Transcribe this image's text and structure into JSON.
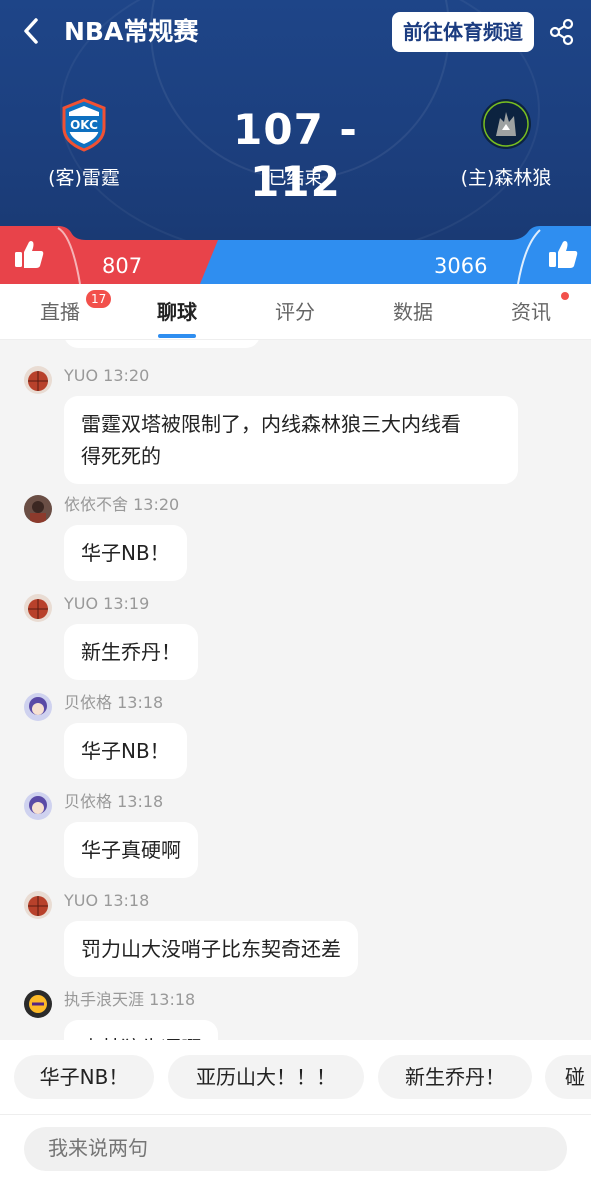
{
  "header": {
    "title": "NBA常规赛",
    "channel_button": "前往体育频道",
    "away": {
      "name": "(客)雷霆",
      "logo_text": "OKC"
    },
    "home": {
      "name": "(主)森林狼"
    },
    "score": "107 - 112",
    "status": "已结束"
  },
  "support": {
    "away_count": "807",
    "home_count": "3066"
  },
  "tabs": [
    {
      "label": "直播",
      "badge": "17"
    },
    {
      "label": "聊球"
    },
    {
      "label": "评分"
    },
    {
      "label": "数据"
    },
    {
      "label": "资讯"
    }
  ],
  "messages": [
    {
      "user": "YUO",
      "time": "13:20",
      "text_lines": [
        "雷霆双塔被限制了，内线森林狼三大内线看",
        "得死死的"
      ]
    },
    {
      "user": "依依不舍",
      "time": "13:20",
      "text_lines": [
        "华子NB！"
      ]
    },
    {
      "user": "YUO",
      "time": "13:19",
      "text_lines": [
        "新生乔丹！"
      ]
    },
    {
      "user": "贝依格",
      "time": "13:18",
      "text_lines": [
        "华子NB！"
      ]
    },
    {
      "user": "贝依格",
      "time": "13:18",
      "text_lines": [
        "华子真硬啊"
      ]
    },
    {
      "user": "YUO",
      "time": "13:18",
      "text_lines": [
        "罚力山大没哨子比东契奇还差"
      ]
    },
    {
      "user": "执手浪天涯",
      "time": "13:18",
      "text_lines": [
        "森林狼牛逼啊"
      ]
    }
  ],
  "quick_replies": [
    "华子NB！",
    "亚历山大！！！",
    "新生乔丹！",
    "碰"
  ],
  "input": {
    "placeholder": "我来说两句"
  },
  "colors": {
    "header_bg": "#1e4588",
    "away_support": "#e8434a",
    "home_support": "#2f8ef0",
    "tab_active": "#2f8ef0",
    "badge": "#f2504b"
  }
}
